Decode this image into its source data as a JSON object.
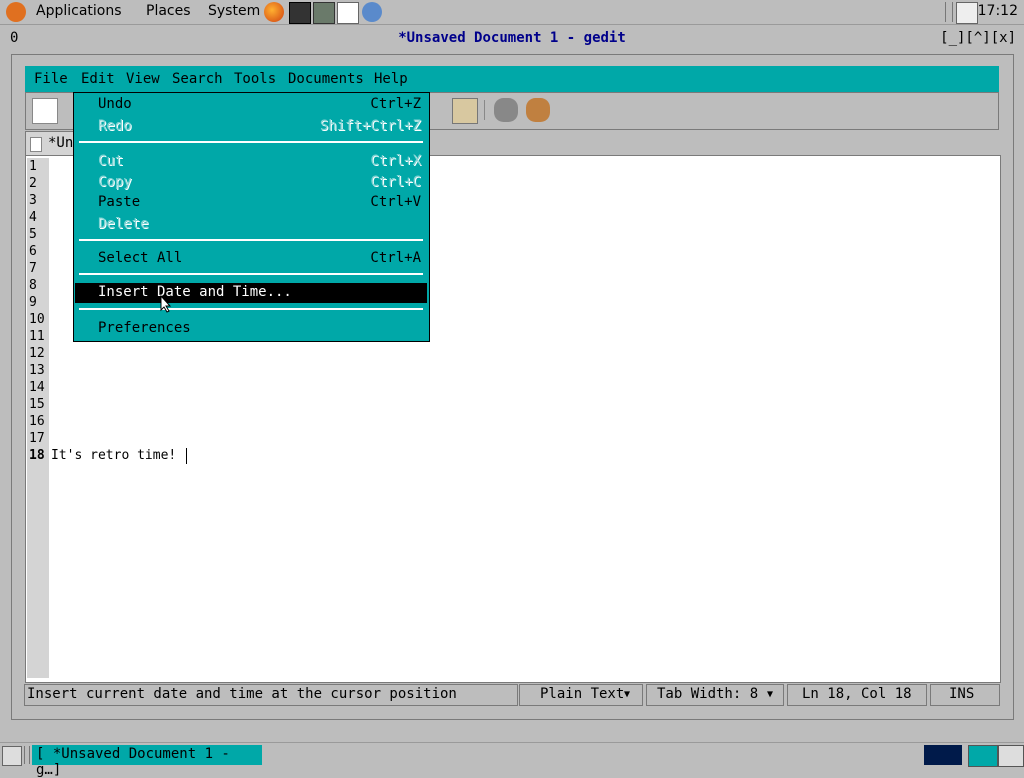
{
  "top_panel": {
    "applications": "Applications",
    "places": "Places",
    "system": "System",
    "clock": "17:12"
  },
  "window": {
    "left_label": "0",
    "title": "*Unsaved Document 1 - gedit",
    "controls": "[_][^][x]"
  },
  "menubar": {
    "file": "File",
    "edit": "Edit",
    "view": "View",
    "search": "Search",
    "tools": "Tools",
    "documents": "Documents",
    "help": "Help"
  },
  "tab": {
    "label": "*Un"
  },
  "editor": {
    "line_numbers": [
      "1",
      "2",
      "3",
      "4",
      "5",
      "6",
      "7",
      "8",
      "9",
      "10",
      "11",
      "12",
      "13",
      "14",
      "15",
      "16",
      "17",
      "18"
    ],
    "text_line": "It's retro time!"
  },
  "edit_menu": {
    "undo": {
      "label": "Undo",
      "accel": "Ctrl+Z"
    },
    "redo": {
      "label": "Redo",
      "accel": "Shift+Ctrl+Z"
    },
    "cut": {
      "label": "Cut",
      "accel": "Ctrl+X"
    },
    "copy": {
      "label": "Copy",
      "accel": "Ctrl+C"
    },
    "paste": {
      "label": "Paste",
      "accel": "Ctrl+V"
    },
    "delete": {
      "label": "Delete"
    },
    "select_all": {
      "label": "Select All",
      "accel": "Ctrl+A"
    },
    "insert_date": {
      "label": "Insert Date and Time..."
    },
    "preferences": {
      "label": "Preferences"
    }
  },
  "statusbar": {
    "message": "Insert current date and time at the cursor position",
    "language": "Plain Text",
    "tab_width": "Tab Width: 8",
    "position": "Ln 18, Col 18",
    "mode": "INS"
  },
  "taskbar": {
    "button": "[ *Unsaved Document 1 - g…]"
  },
  "colors": {
    "accent": "#00a8a8",
    "title": "#00008b"
  }
}
